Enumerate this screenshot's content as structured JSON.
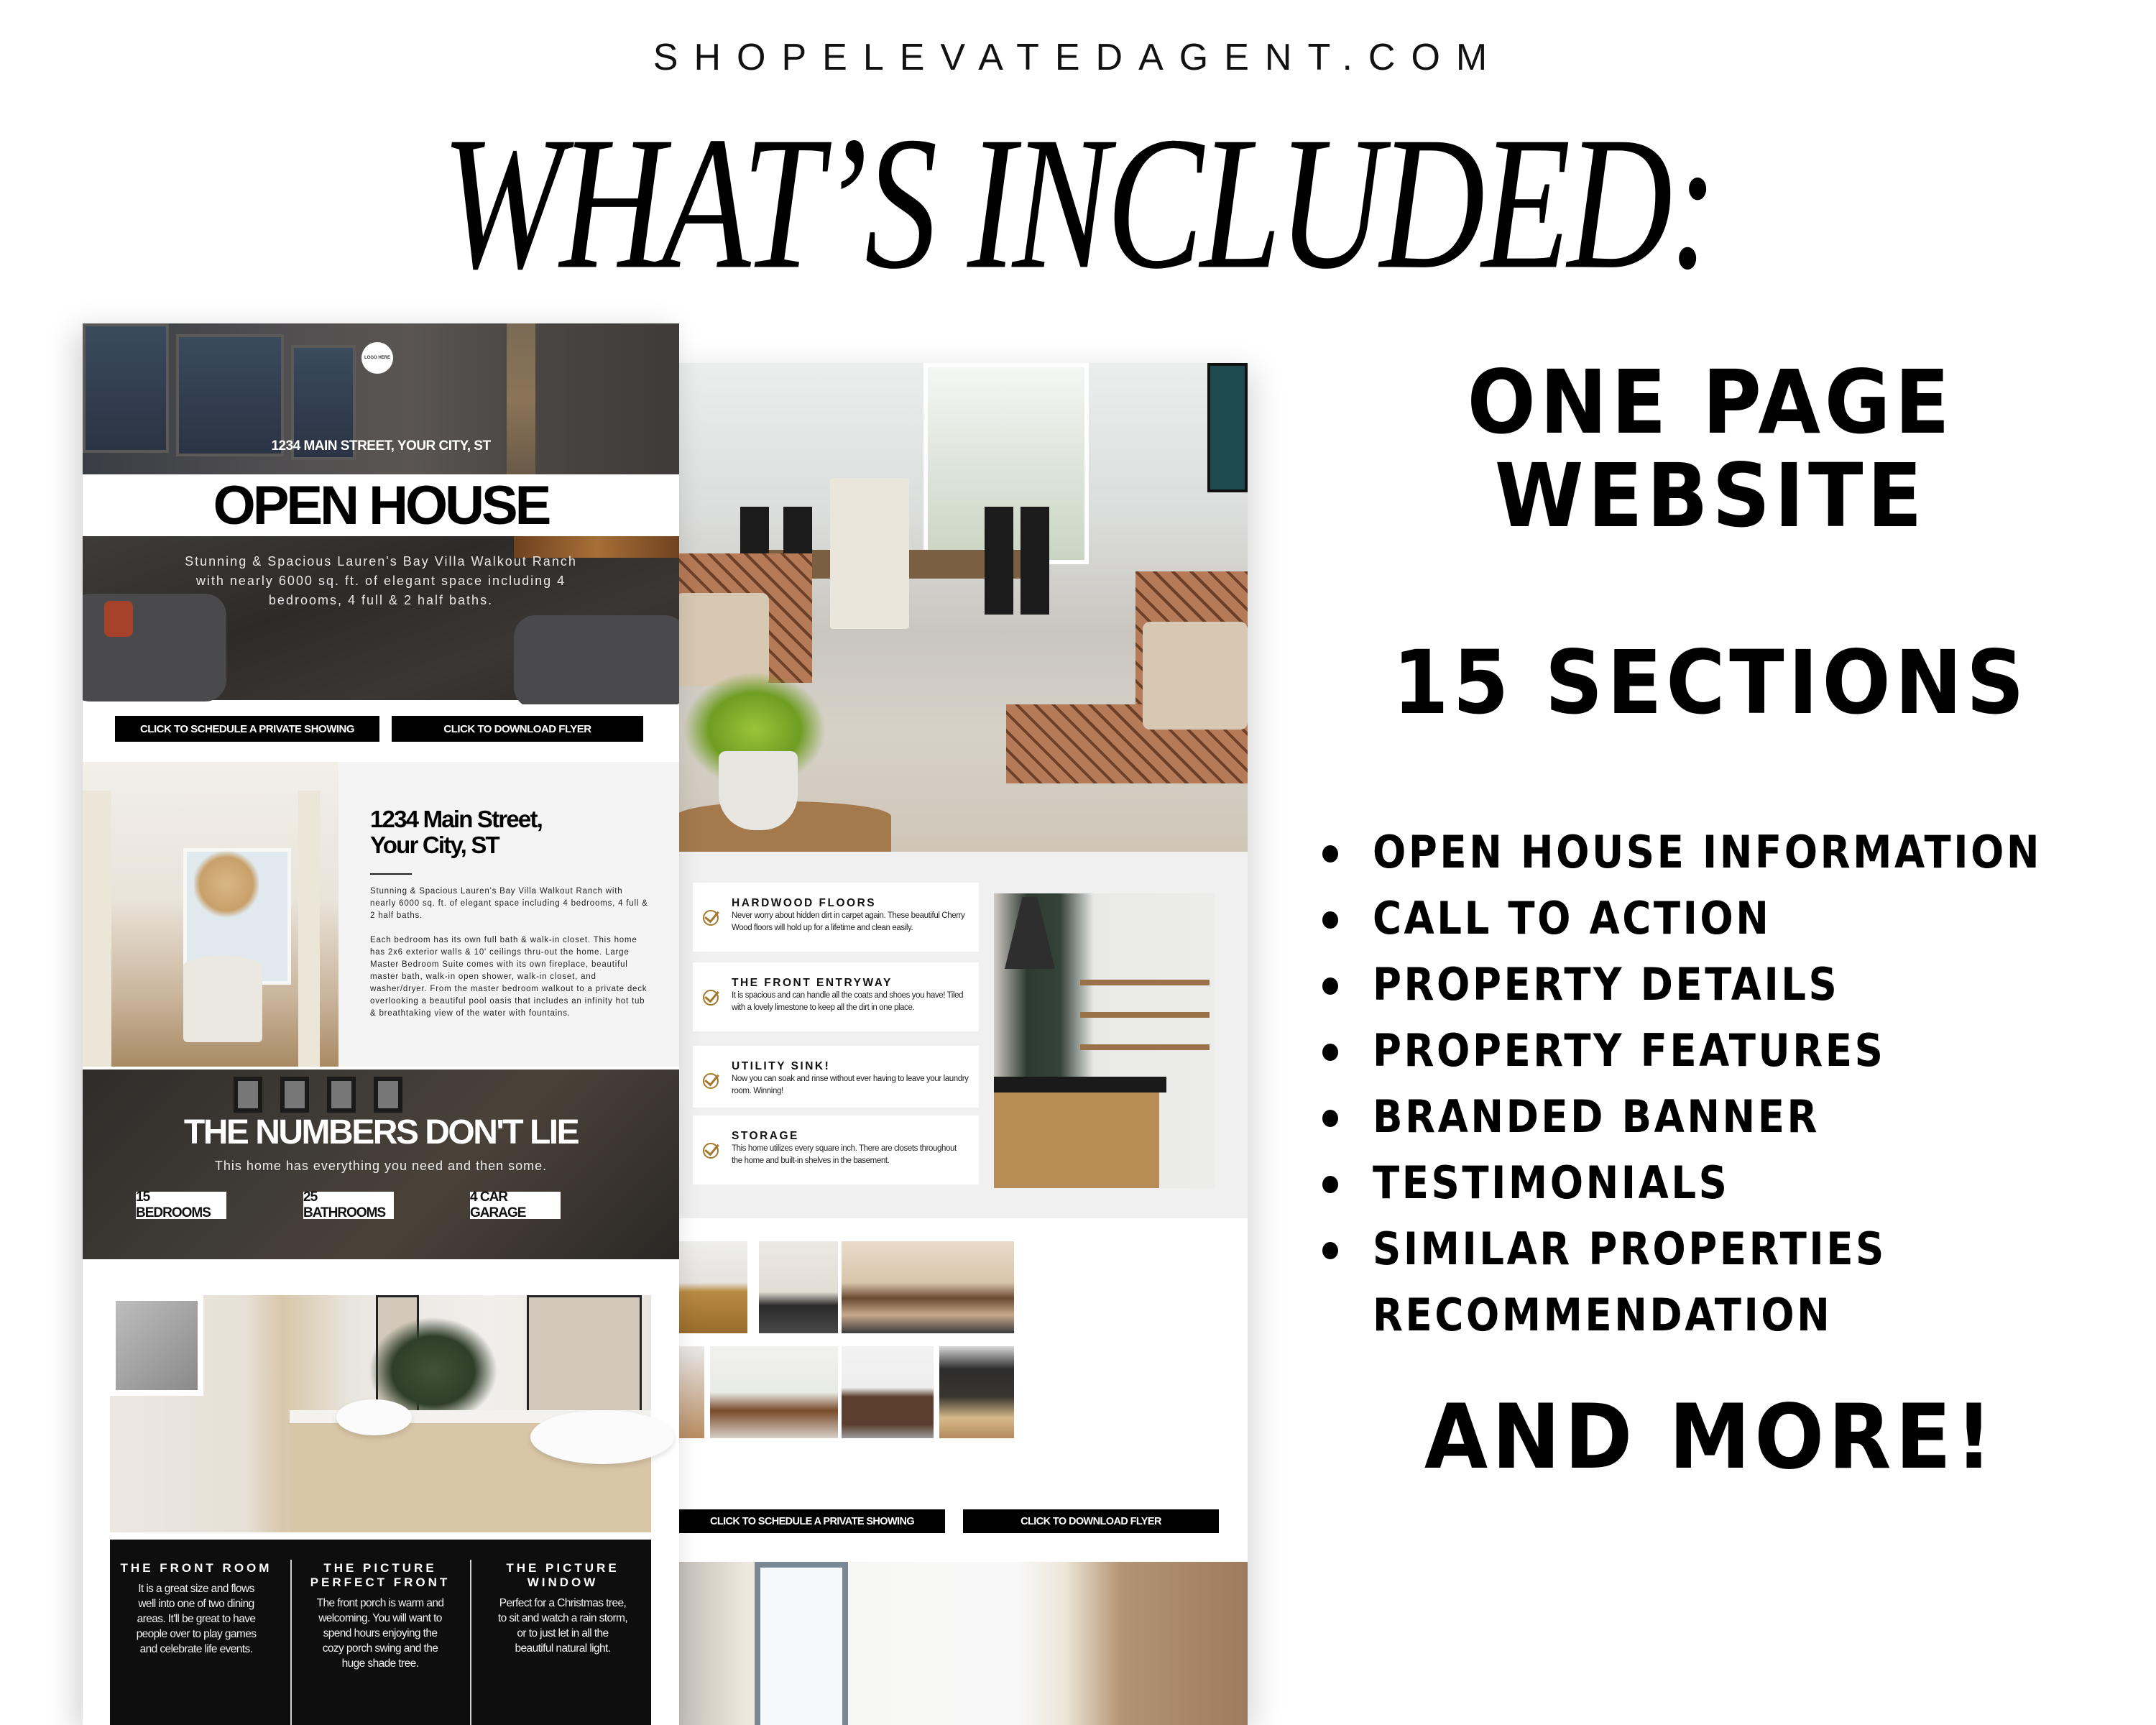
{
  "header": {
    "site_url": "SHOPELEVATEDAGENT.COM",
    "title": "WHAT’S INCLUDED:"
  },
  "left_mockup": {
    "hero": {
      "logo_text": "LOGO HERE",
      "address": "1234 MAIN STREET, YOUR CITY, ST",
      "title": "OPEN HOUSE",
      "description": "Stunning & Spacious Lauren's Bay Villa Walkout Ranch with nearly 6000 sq. ft. of elegant space including 4 bedrooms, 4 full & 2 half baths."
    },
    "cta": {
      "schedule_label": "CLICK TO SCHEDULE A PRIVATE SHOWING",
      "flyer_label": "CLICK TO DOWNLOAD FLYER"
    },
    "details": {
      "title_line1": "1234 Main Street,",
      "title_line2": "Your City, ST",
      "paragraph1": "Stunning & Spacious Lauren's Bay Villa Walkout Ranch with nearly 6000 sq. ft. of elegant space including 4 bedrooms, 4 full & 2 half baths.",
      "paragraph2": "Each bedroom has its own full bath & walk-in closet. This home has 2x6 exterior walls & 10' ceilings thru-out the home. Large Master Bedroom Suite comes with its own fireplace, beautiful master bath, walk-in open shower, walk-in closet, and washer/dryer. From the master bedroom walkout to a private deck overlooking a beautiful pool oasis that includes an infinity hot tub & breathtaking view of the water with fountains."
    },
    "numbers": {
      "title": "THE NUMBERS DON'T LIE",
      "subtitle": "This home has everything you need and then some.",
      "stats": [
        "15 BEDROOMS",
        "25 BATHROOMS",
        "4 CAR GARAGE"
      ]
    },
    "feature_band": [
      {
        "title": "THE FRONT ROOM",
        "text": "It is a great size and flows well into one of two dining areas. It'll be great to have people over to play games and celebrate life events."
      },
      {
        "title": "THE PICTURE PERFECT FRONT",
        "text": "The front porch is warm and welcoming. You will want to spend hours enjoying the cozy porch swing and the huge shade tree."
      },
      {
        "title": "THE PICTURE WINDOW",
        "text": "Perfect for a Christmas tree, to sit and watch a rain storm, or to just let in all the beautiful natural light."
      }
    ]
  },
  "right_mockup": {
    "features": [
      {
        "title": "HARDWOOD FLOORS",
        "text": "Never worry about hidden dirt in carpet again. These beautiful Cherry Wood floors will hold up for a lifetime and clean easily."
      },
      {
        "title": "THE FRONT ENTRYWAY",
        "text": "It is spacious and can handle all the coats and shoes you have! Tiled with a lovely limestone to keep all the dirt in one place."
      },
      {
        "title": "UTILITY SINK!",
        "text": "Now you can soak and rinse without ever having to leave your laundry room. Winning!"
      },
      {
        "title": "STORAGE",
        "text": "This home utilizes every square inch. There are closets throughout the home and built-in shelves in the basement."
      }
    ],
    "check_icon_color": "#a3782c",
    "cta": {
      "schedule_label": "CLICK TO SCHEDULE A PRIVATE SHOWING",
      "flyer_label": "CLICK TO DOWNLOAD FLYER"
    }
  },
  "side": {
    "headline1_line1": "ONE PAGE",
    "headline1_line2": "WEBSITE",
    "headline2": "15 SECTIONS",
    "features": [
      "OPEN HOUSE INFORMATION",
      "CALL TO ACTION",
      "PROPERTY DETAILS",
      "PROPERTY FEATURES",
      "BRANDED BANNER",
      "TESTIMONIALS",
      "SIMILAR PROPERTIES"
    ],
    "features_continuation": "RECOMMENDATION",
    "headline3": "AND MORE!"
  }
}
